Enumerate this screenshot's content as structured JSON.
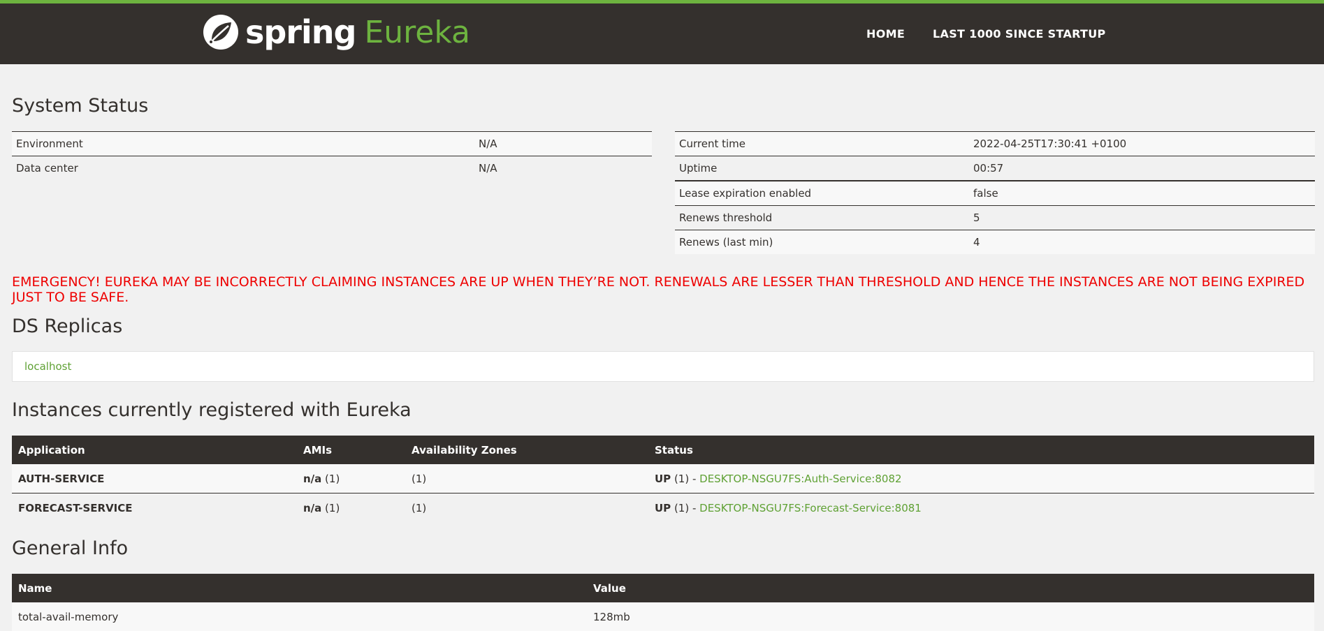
{
  "brand": {
    "word1": "spring",
    "word2": "Eureka"
  },
  "nav": {
    "home": "HOME",
    "last1000": "LAST 1000 SINCE STARTUP"
  },
  "system_status": {
    "title": "System Status",
    "left": [
      {
        "name": "Environment",
        "value": "N/A"
      },
      {
        "name": "Data center",
        "value": "N/A"
      }
    ],
    "right": [
      {
        "name": "Current time",
        "value": "2022-04-25T17:30:41 +0100"
      },
      {
        "name": "Uptime",
        "value": "00:57"
      },
      {
        "name": "Lease expiration enabled",
        "value": "false"
      },
      {
        "name": "Renews threshold",
        "value": "5"
      },
      {
        "name": "Renews (last min)",
        "value": "4"
      }
    ]
  },
  "emergency": "EMERGENCY! EUREKA MAY BE INCORRECTLY CLAIMING INSTANCES ARE UP WHEN THEY’RE NOT. RENEWALS ARE LESSER THAN THRESHOLD AND HENCE THE INSTANCES ARE NOT BEING EXPIRED JUST TO BE SAFE.",
  "ds_replicas": {
    "title": "DS Replicas",
    "items": [
      "localhost"
    ]
  },
  "instances": {
    "title": "Instances currently registered with Eureka",
    "columns": [
      "Application",
      "AMIs",
      "Availability Zones",
      "Status"
    ],
    "rows": [
      {
        "app": "AUTH-SERVICE",
        "ami_bold": "n/a",
        "ami_count": " (1)",
        "zones": "(1)",
        "status_bold": "UP",
        "status_count": " (1) - ",
        "link": "DESKTOP-NSGU7FS:Auth-Service:8082"
      },
      {
        "app": "FORECAST-SERVICE",
        "ami_bold": "n/a",
        "ami_count": " (1)",
        "zones": "(1)",
        "status_bold": "UP",
        "status_count": " (1) - ",
        "link": "DESKTOP-NSGU7FS:Forecast-Service:8081"
      }
    ]
  },
  "general_info": {
    "title": "General Info",
    "columns": [
      "Name",
      "Value"
    ],
    "rows": [
      {
        "name": "total-avail-memory",
        "value": "128mb"
      }
    ]
  },
  "colors": {
    "accent": "#6db33f",
    "dark": "#34302d",
    "link": "#5fa134",
    "emergency": "#ee0000"
  }
}
